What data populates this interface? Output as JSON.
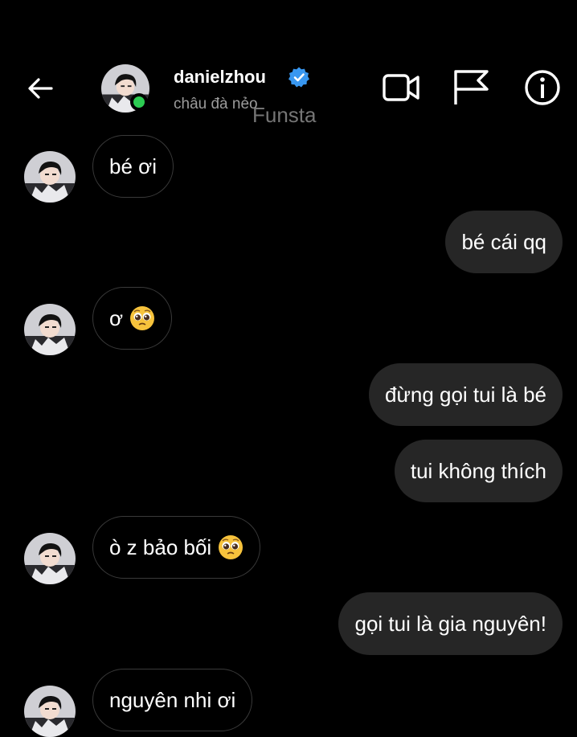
{
  "header": {
    "username": "danielzhou",
    "status": "châu đà nẻo",
    "watermark": "Funsta"
  },
  "messages": [
    {
      "dir": "in",
      "text": "bé ơi",
      "emoji": null
    },
    {
      "dir": "out",
      "text": "bé cái qq",
      "emoji": null
    },
    {
      "dir": "in",
      "text": "ơ",
      "emoji": "pleading-face"
    },
    {
      "dir": "out",
      "text": "đừng gọi tui là bé",
      "emoji": null
    },
    {
      "dir": "out",
      "text": "tui không thích",
      "emoji": null
    },
    {
      "dir": "in",
      "text": "ò z bảo bối",
      "emoji": "pleading-face"
    },
    {
      "dir": "out",
      "text": "gọi tui là gia nguyên!",
      "emoji": null
    },
    {
      "dir": "in",
      "text": "nguyên nhi ơi",
      "emoji": null
    }
  ],
  "colors": {
    "background": "#000000",
    "outgoing_bubble": "#262626",
    "incoming_border": "#3a3a3a",
    "verified": "#3897f0",
    "online": "#2ccc52",
    "secondary_text": "#9b9b9b"
  },
  "icons": [
    "back-arrow-icon",
    "verified-badge-icon",
    "video-call-icon",
    "flag-icon",
    "info-icon",
    "pleading-face-emoji"
  ]
}
